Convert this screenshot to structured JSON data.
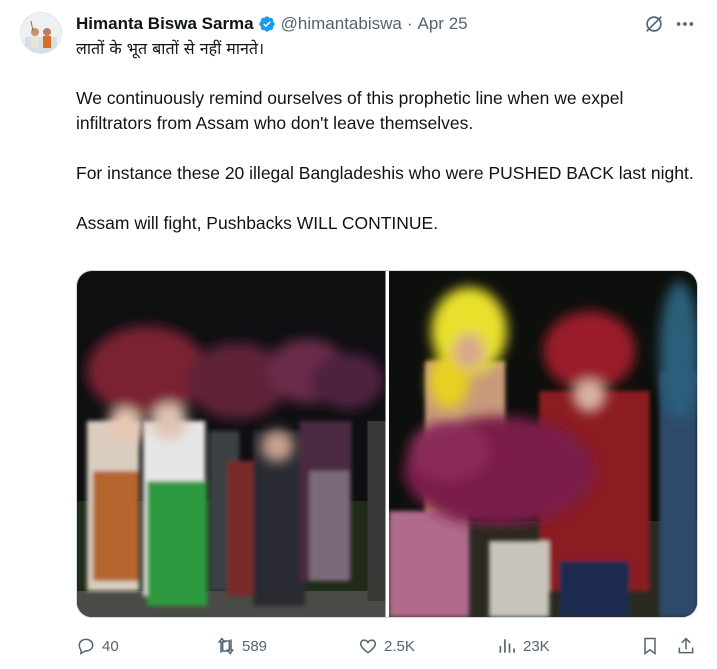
{
  "author": {
    "name": "Himanta Biswa Sarma",
    "handle": "@himantabiswa",
    "separator": "·",
    "date": "Apr 25",
    "verified_color": "#1d9bf0"
  },
  "tweet": {
    "line1": "लातों के भूत बातों से नहीं मानते।",
    "line2": "We continuously remind ourselves of this prophetic line when we expel infiltrators from Assam who don't leave themselves.",
    "line3": "For instance these 20 illegal Bangladeshis who were PUSHED BACK last night.",
    "line4": "Assam will fight, Pushbacks WILL CONTINUE."
  },
  "icons": {
    "grok": "grok-icon",
    "more": "more-icon",
    "reply": "reply-icon",
    "retweet": "retweet-icon",
    "like": "heart-icon",
    "views": "views-icon",
    "bookmark": "bookmark-icon",
    "share": "share-icon"
  },
  "actions": {
    "replies": "40",
    "reposts": "589",
    "likes": "2.5K",
    "views": "23K"
  },
  "colors": {
    "text": "#0f1419",
    "secondary": "#536471",
    "accent": "#1d9bf0"
  }
}
